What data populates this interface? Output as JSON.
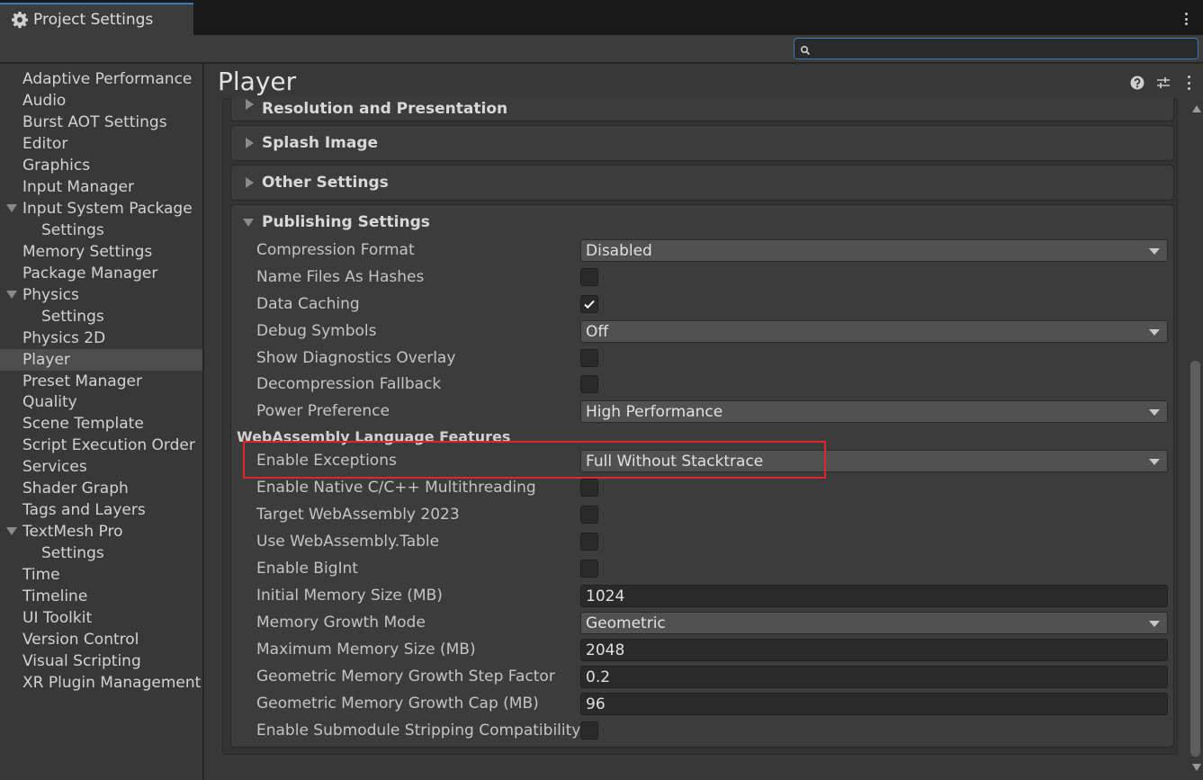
{
  "window": {
    "tab_title": "Project Settings"
  },
  "search": {
    "value": ""
  },
  "sidebar": {
    "items": [
      {
        "label": "Adaptive Performance"
      },
      {
        "label": "Audio"
      },
      {
        "label": "Burst AOT Settings"
      },
      {
        "label": "Editor"
      },
      {
        "label": "Graphics"
      },
      {
        "label": "Input Manager"
      },
      {
        "label": "Input System Package",
        "expanded": true
      },
      {
        "label": "Settings",
        "child": true
      },
      {
        "label": "Memory Settings"
      },
      {
        "label": "Package Manager"
      },
      {
        "label": "Physics",
        "expanded": true
      },
      {
        "label": "Settings",
        "child": true
      },
      {
        "label": "Physics 2D"
      },
      {
        "label": "Player",
        "selected": true
      },
      {
        "label": "Preset Manager"
      },
      {
        "label": "Quality"
      },
      {
        "label": "Scene Template"
      },
      {
        "label": "Script Execution Order"
      },
      {
        "label": "Services"
      },
      {
        "label": "Shader Graph"
      },
      {
        "label": "Tags and Layers"
      },
      {
        "label": "TextMesh Pro",
        "expanded": true
      },
      {
        "label": "Settings",
        "child": true
      },
      {
        "label": "Time"
      },
      {
        "label": "Timeline"
      },
      {
        "label": "UI Toolkit"
      },
      {
        "label": "Version Control"
      },
      {
        "label": "Visual Scripting"
      },
      {
        "label": "XR Plugin Management"
      }
    ]
  },
  "main": {
    "title": "Player",
    "sections": {
      "resolution": "Resolution and Presentation",
      "splash": "Splash Image",
      "other": "Other Settings",
      "publishing": "Publishing Settings"
    },
    "publishing": {
      "compression_format": {
        "label": "Compression Format",
        "value": "Disabled"
      },
      "name_files_as_hashes": {
        "label": "Name Files As Hashes",
        "checked": false
      },
      "data_caching": {
        "label": "Data Caching",
        "checked": true
      },
      "debug_symbols": {
        "label": "Debug Symbols",
        "value": "Off"
      },
      "show_diagnostics_overlay": {
        "label": "Show Diagnostics Overlay",
        "checked": false
      },
      "decompression_fallback": {
        "label": "Decompression Fallback",
        "checked": false
      },
      "power_preference": {
        "label": "Power Preference",
        "value": "High Performance"
      },
      "wasm_features_heading": "WebAssembly Language Features",
      "enable_exceptions": {
        "label": "Enable Exceptions",
        "value": "Full Without Stacktrace"
      },
      "native_multithreading": {
        "label": "Enable Native C/C++ Multithreading",
        "checked": false
      },
      "target_wasm_2023": {
        "label": "Target WebAssembly 2023",
        "checked": false
      },
      "use_wasm_table": {
        "label": "Use WebAssembly.Table",
        "checked": false
      },
      "enable_bigint": {
        "label": "Enable BigInt",
        "checked": false
      },
      "initial_memory_size": {
        "label": "Initial Memory Size (MB)",
        "value": "1024"
      },
      "memory_growth_mode": {
        "label": "Memory Growth Mode",
        "value": "Geometric"
      },
      "maximum_memory_size": {
        "label": "Maximum Memory Size (MB)",
        "value": "2048"
      },
      "geometric_step_factor": {
        "label": "Geometric Memory Growth Step Factor",
        "value": "0.2"
      },
      "geometric_growth_cap": {
        "label": "Geometric Memory Growth Cap (MB)",
        "value": "96"
      },
      "submodule_stripping": {
        "label": "Enable Submodule Stripping Compatibility",
        "checked": false
      }
    }
  },
  "colors": {
    "accent": "#3a79bb",
    "highlight": "#e02727",
    "panel": "#383838",
    "selected": "#4d4d4d"
  },
  "icons": {
    "tab": "gear-icon",
    "search": "search-icon",
    "help": "help-icon",
    "presets": "presets-icon",
    "menu": "kebab-menu-icon"
  }
}
